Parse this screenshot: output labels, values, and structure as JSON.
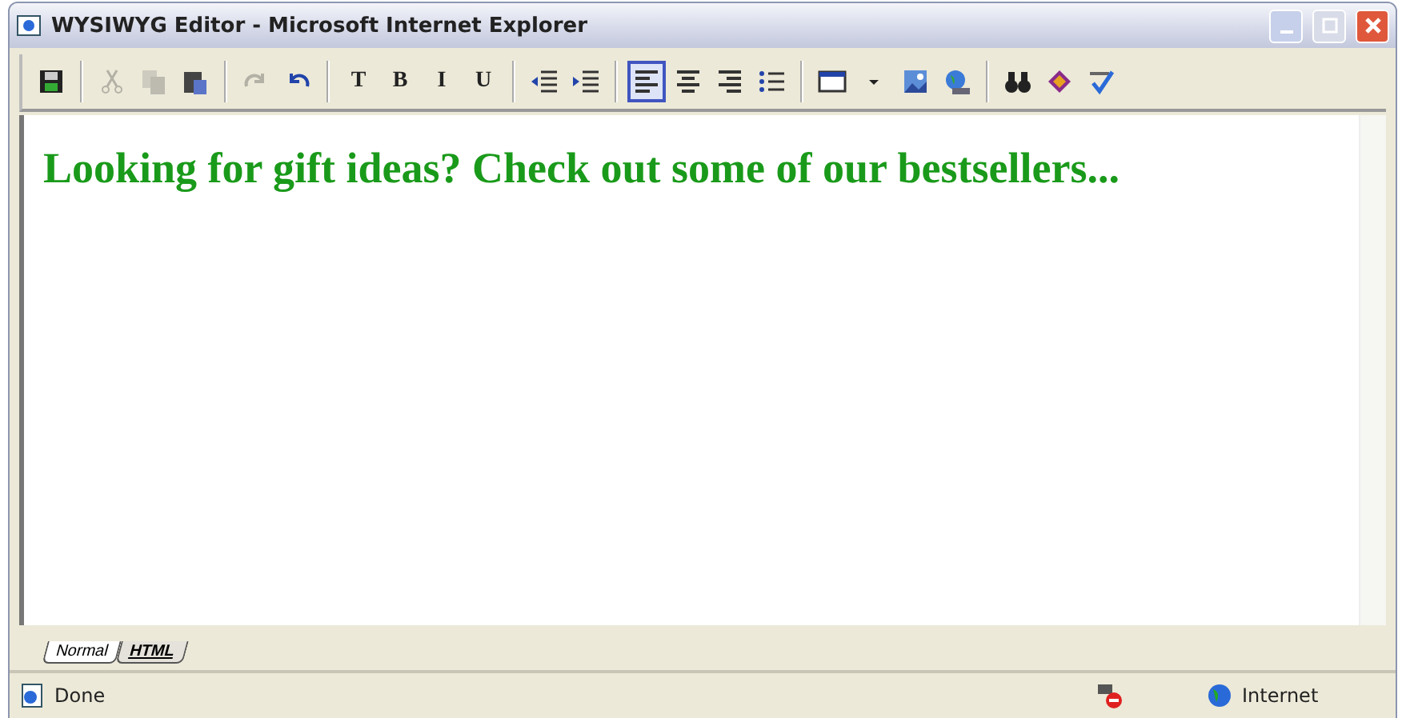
{
  "window": {
    "title": "WYSIWYG Editor - Microsoft Internet Explorer"
  },
  "toolbar": [
    [
      {
        "disabled": false,
        "selected": false
      }
    ],
    [
      {
        "disabled": true,
        "selected": false
      },
      {
        "disabled": true,
        "selected": false
      },
      {
        "disabled": false,
        "selected": false
      }
    ],
    [
      {
        "disabled": true,
        "selected": false
      },
      {
        "disabled": false,
        "selected": false
      }
    ],
    [
      {
        "label": "T",
        "disabled": false,
        "selected": false
      },
      {
        "label": "B",
        "disabled": false,
        "selected": false
      },
      {
        "label": "I",
        "disabled": false,
        "selected": false
      },
      {
        "label": "U",
        "disabled": false,
        "selected": false
      }
    ],
    [
      {
        "disabled": false,
        "selected": false
      },
      {
        "disabled": false,
        "selected": false
      }
    ],
    [
      {
        "disabled": false,
        "selected": true
      },
      {
        "disabled": false,
        "selected": false
      },
      {
        "disabled": false,
        "selected": false
      },
      {
        "disabled": false,
        "selected": false
      }
    ],
    [
      {
        "disabled": false,
        "selected": false
      },
      {
        "disabled": false,
        "selected": false
      },
      {
        "disabled": false,
        "selected": false
      },
      {
        "disabled": false,
        "selected": false
      }
    ],
    [
      {
        "disabled": false,
        "selected": false
      },
      {
        "disabled": false,
        "selected": false
      },
      {
        "disabled": false,
        "selected": false
      }
    ]
  ],
  "editor": {
    "heading": "Looking for gift ideas? Check out some of our bestsellers..."
  },
  "tabs": [
    {
      "label": "Normal",
      "selected": true
    },
    {
      "label": "HTML",
      "selected": false
    }
  ],
  "status_bar": {
    "status": "Done",
    "zone": "Internet"
  }
}
